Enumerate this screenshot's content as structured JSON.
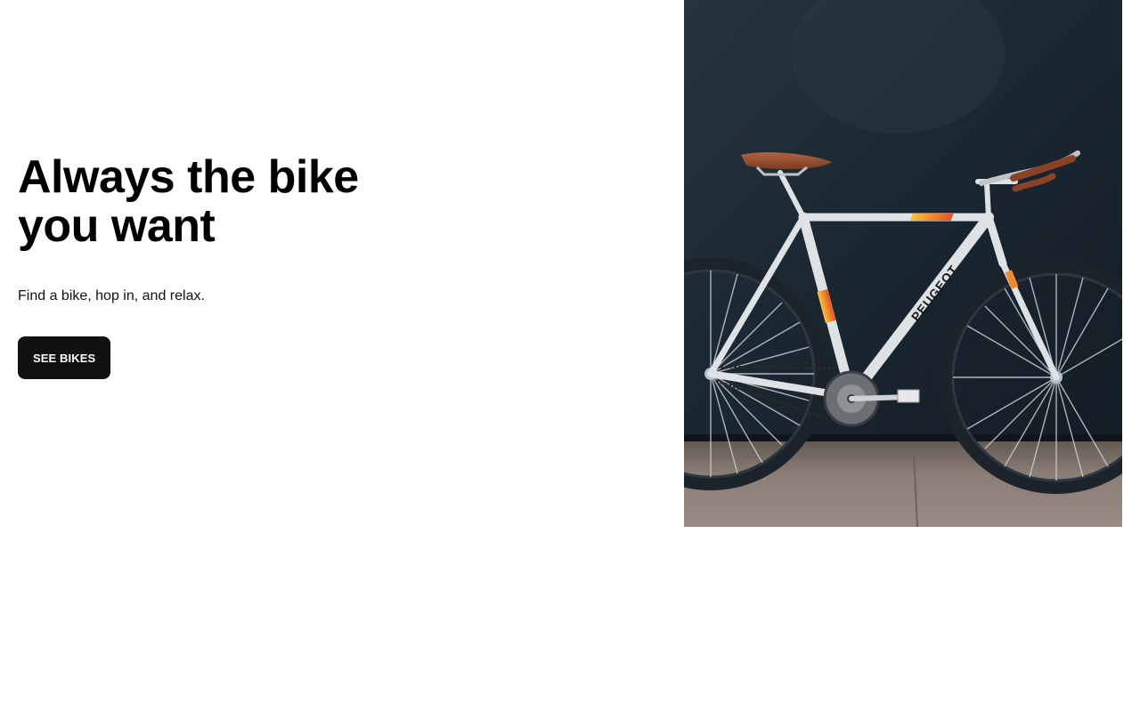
{
  "hero": {
    "title_line1": "Always the bike",
    "title_line2": "you want",
    "subtitle": "Find a bike, hop in, and relax.",
    "cta_label": "SEE BIKES",
    "image": {
      "subject": "white road bicycle against dark wall",
      "frame_brand_text": "PEUGEOT"
    }
  },
  "colors": {
    "background": "#ffffff",
    "text": "#000000",
    "button_bg": "#111111",
    "button_text": "#ffffff",
    "wall": "#1b2733",
    "floor": "#8a7d75"
  }
}
